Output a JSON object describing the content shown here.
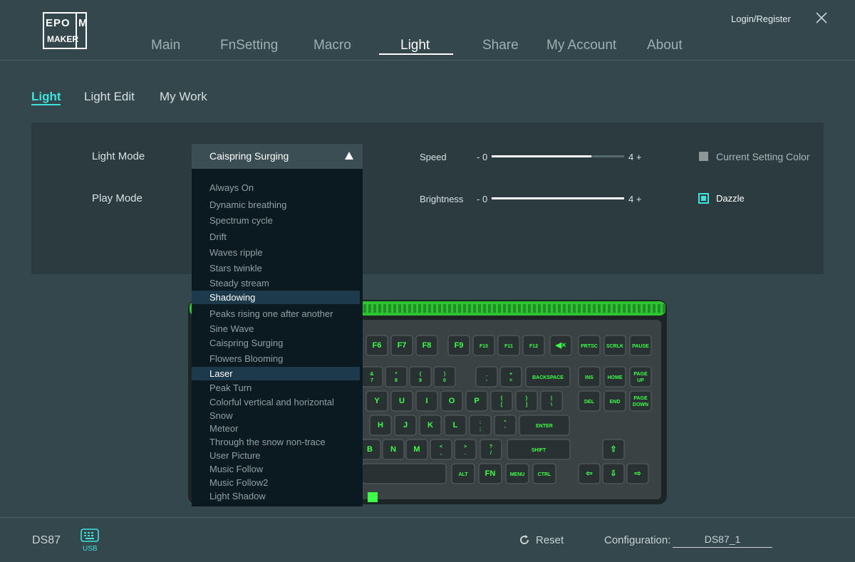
{
  "header": {
    "logo_text": "EPOM MAKER",
    "login_label": "Login/Register",
    "nav": [
      "Main",
      "FnSetting",
      "Macro",
      "Light",
      "Share",
      "My Account",
      "About"
    ],
    "active_nav": "Light"
  },
  "subtabs": {
    "items": [
      "Light",
      "Light Edit",
      "My Work"
    ],
    "active": "Light"
  },
  "settings": {
    "light_mode_label": "Light Mode",
    "light_mode_value": "Caispring Surging",
    "play_mode_label": "Play Mode",
    "speed": {
      "label": "Speed",
      "min_label": "- 0",
      "max_label": "4 +",
      "level": 0.75
    },
    "brightness": {
      "label": "Brightness",
      "min_label": "- 0",
      "max_label": "4 +",
      "level": 1.0
    },
    "current_setting_color_label": "Current Setting Color",
    "current_setting_color_checked": false,
    "dazzle_label": "Dazzle",
    "dazzle_checked": true
  },
  "dropdown": {
    "options": [
      "Always On",
      "Dynamic breathing",
      "Spectrum cycle",
      "Drift",
      "Waves ripple",
      "Stars twinkle",
      "Steady stream",
      "Shadowing",
      "Peaks rising one after another",
      "Sine Wave",
      "Caispring Surging",
      "Flowers Blooming",
      "Laser",
      "Peak Turn",
      "Colorful vertical and horizontal",
      "Snow",
      "Meteor",
      "Through the snow non-trace",
      "User Picture",
      "Music Follow",
      "Music Follow2",
      "Light Shadow"
    ],
    "highlighted": [
      "Shadowing",
      "Laser"
    ]
  },
  "keyboard": {
    "fn_keys": [
      "F6",
      "F7",
      "F8",
      "F9",
      "F10",
      "F11",
      "F12",
      "◀×"
    ],
    "nav_top": [
      "PRTSC",
      "SCRLK",
      "PAUSE"
    ],
    "row_num": [
      [
        "&",
        "7"
      ],
      [
        "*",
        "8"
      ],
      [
        "(",
        "9"
      ],
      [
        ")",
        "0"
      ],
      [
        "_",
        "-"
      ],
      [
        "+",
        "="
      ]
    ],
    "backspace": "BACKSPACE",
    "nav_mid1": [
      "INS",
      "HOME",
      "PAGE UP"
    ],
    "row_q": [
      "Y",
      "U",
      "I",
      "O",
      "P",
      "{ [",
      "} ]",
      "| \\"
    ],
    "nav_mid2": [
      "DEL",
      "END",
      "PAGE DOWN"
    ],
    "row_a": [
      "H",
      "J",
      "K",
      "L",
      ": ;",
      "\" '"
    ],
    "enter": "ENTER",
    "row_z": [
      "B",
      "N",
      "M",
      "< ,",
      "> .",
      "? /"
    ],
    "shift": "SHIFT",
    "row_bottom": [
      "ALT",
      "FN",
      "MENU",
      "CTRL"
    ],
    "arrows": [
      "⇧",
      "⇦",
      "⇩",
      "⇨"
    ],
    "accent_color": "#3dff48"
  },
  "footer": {
    "model": "DS87",
    "usb_label": "USB",
    "reset_label": "Reset",
    "config_label": "Configuration:",
    "config_value": "DS87_1"
  }
}
